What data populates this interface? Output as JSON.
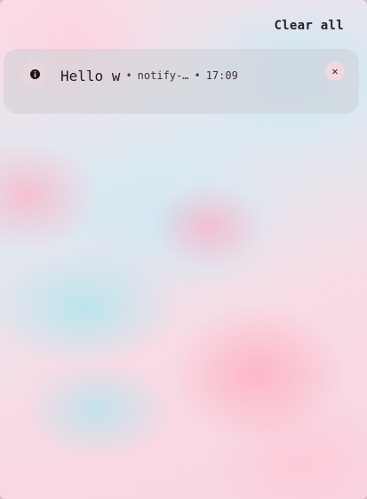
{
  "header": {
    "clear_all_label": "Clear all"
  },
  "notification": {
    "icon": "info-icon",
    "summary": "Hello w",
    "separator": "•",
    "app_name": "notify-…",
    "time": "17:09",
    "close_glyph": "✕"
  }
}
